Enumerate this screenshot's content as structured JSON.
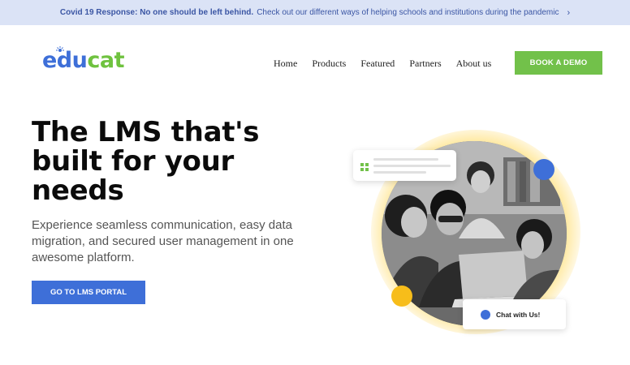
{
  "banner": {
    "bold_text": "Covid 19 Response: No one should be left behind.",
    "text": "Check out our different ways of helping schools and institutions during the pandemic",
    "chevron": "›"
  },
  "logo": {
    "part1": "edu",
    "part2": "cat"
  },
  "nav": {
    "items": [
      "Home",
      "Products",
      "Featured",
      "Partners",
      "About us"
    ]
  },
  "header": {
    "cta_label": "BOOK A DEMO"
  },
  "hero": {
    "title": "The LMS that's\nbuilt for your\nneeds",
    "subtitle": "Experience seamless communication, easy data migration, and secured user management in one awesome platform.",
    "cta_label": "GO TO LMS PORTAL"
  },
  "illustration": {
    "chat_label": "Chat with Us!"
  },
  "colors": {
    "brand_blue": "#3e6fd8",
    "brand_green": "#72c14a",
    "accent_yellow": "#f7bd1a",
    "banner_bg": "#dbe3f6"
  }
}
